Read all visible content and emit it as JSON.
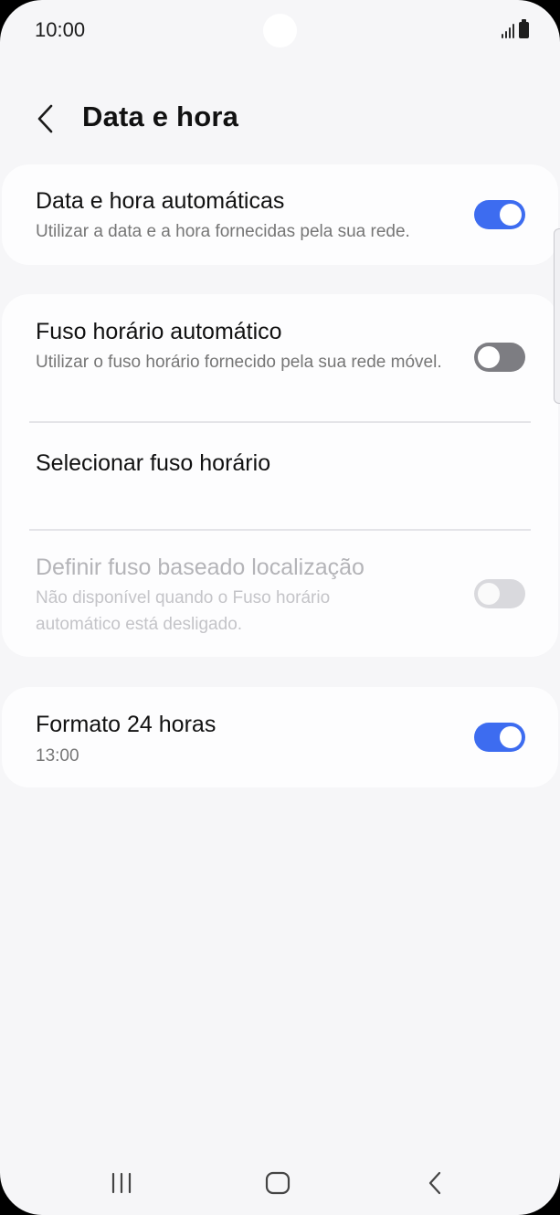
{
  "status_bar": {
    "time": "10:00",
    "signal_icon": "signal-bars-icon",
    "battery_icon": "battery-icon"
  },
  "header": {
    "back_icon": "chevron-left-icon",
    "title": "Data e hora"
  },
  "settings": {
    "auto_datetime": {
      "title": "Data e hora automáticas",
      "subtitle": "Utilizar a data e a hora fornecidas pela sua rede.",
      "toggle_on": true
    },
    "auto_timezone": {
      "title": "Fuso horário automático",
      "subtitle": "Utilizar o fuso horário fornecido pela sua rede móvel.",
      "toggle_on": false
    },
    "select_timezone": {
      "title": "Selecionar fuso horário"
    },
    "location_timezone": {
      "title": "Definir fuso baseado localização",
      "subtitle": "Não disponível quando o Fuso horário automático está desligado.",
      "toggle_on": false,
      "enabled": false
    },
    "format_24h": {
      "title": "Formato 24 horas",
      "subtitle": "13:00",
      "toggle_on": true
    }
  },
  "colors": {
    "accent": "#3d6cf0",
    "background": "#f6f6f8",
    "card": "#fdfdfe"
  },
  "nav_bar": {
    "recents_icon": "recents-icon",
    "home_icon": "home-icon",
    "back_icon": "back-arrow-icon"
  }
}
